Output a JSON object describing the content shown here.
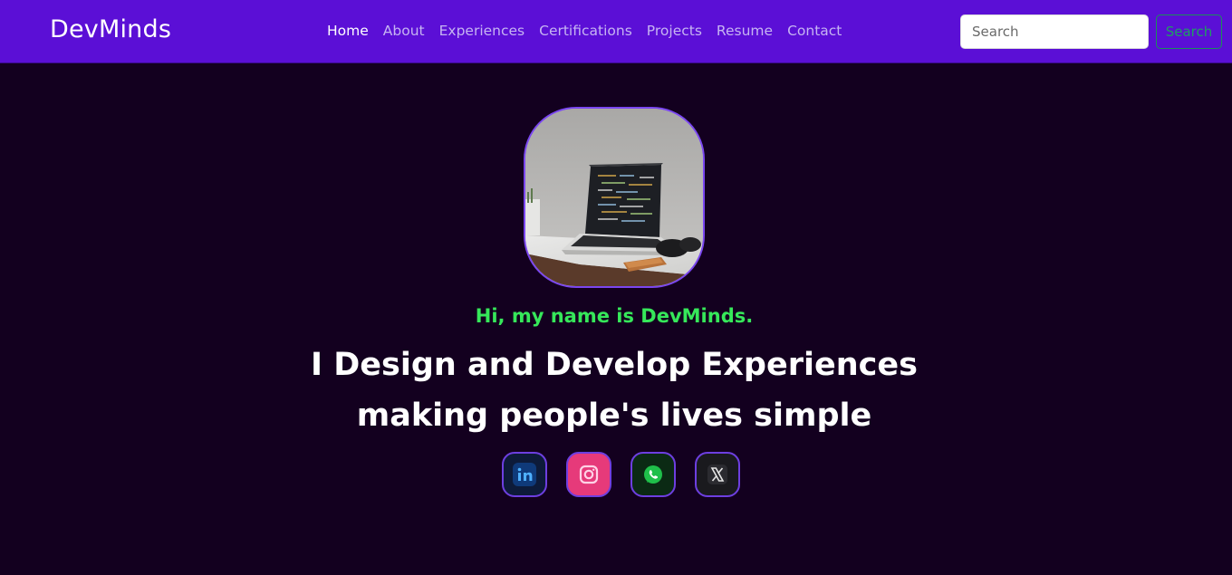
{
  "navbar": {
    "brand": "DevMinds",
    "links": [
      {
        "label": "Home",
        "active": true
      },
      {
        "label": "About",
        "active": false
      },
      {
        "label": "Experiences",
        "active": false
      },
      {
        "label": "Certifications",
        "active": false
      },
      {
        "label": "Projects",
        "active": false
      },
      {
        "label": "Resume",
        "active": false
      },
      {
        "label": "Contact",
        "active": false
      }
    ],
    "search": {
      "placeholder": "Search",
      "button_label": "Search"
    }
  },
  "hero": {
    "greeting": "Hi, my name is DevMinds.",
    "headline_line1": "I Design and Develop Experiences",
    "headline_line2": "making people's lives simple",
    "socials": [
      {
        "icon": "linkedin-icon"
      },
      {
        "icon": "instagram-icon"
      },
      {
        "icon": "whatsapp-icon"
      },
      {
        "icon": "x-twitter-icon"
      }
    ]
  },
  "colors": {
    "navbar": "#5b0fd6",
    "background": "#13001f",
    "greeting": "#36e85a",
    "accent_border": "#7a46f0"
  }
}
